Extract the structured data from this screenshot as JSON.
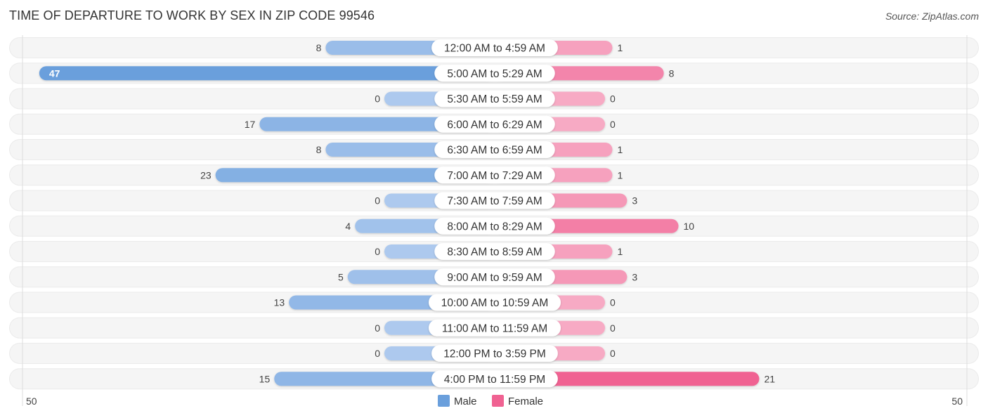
{
  "title": "TIME OF DEPARTURE TO WORK BY SEX IN ZIP CODE 99546",
  "source": "Source: ZipAtlas.com",
  "chart_data": {
    "type": "bar",
    "orientation": "horizontal-diverging",
    "title": "TIME OF DEPARTURE TO WORK BY SEX IN ZIP CODE 99546",
    "categories": [
      "12:00 AM to 4:59 AM",
      "5:00 AM to 5:29 AM",
      "5:30 AM to 5:59 AM",
      "6:00 AM to 6:29 AM",
      "6:30 AM to 6:59 AM",
      "7:00 AM to 7:29 AM",
      "7:30 AM to 7:59 AM",
      "8:00 AM to 8:29 AM",
      "8:30 AM to 8:59 AM",
      "9:00 AM to 9:59 AM",
      "10:00 AM to 10:59 AM",
      "11:00 AM to 11:59 AM",
      "12:00 PM to 3:59 PM",
      "4:00 PM to 11:59 PM"
    ],
    "series": [
      {
        "name": "Male",
        "color": "#6a9fdc",
        "values": [
          8,
          47,
          0,
          17,
          8,
          23,
          0,
          4,
          0,
          5,
          13,
          0,
          0,
          15
        ]
      },
      {
        "name": "Female",
        "color": "#f06292",
        "values": [
          1,
          8,
          0,
          0,
          1,
          1,
          3,
          10,
          1,
          3,
          0,
          0,
          0,
          21
        ]
      }
    ],
    "axis": {
      "left_label": "50",
      "right_label": "50",
      "xlim": [
        -50,
        50
      ]
    },
    "legend": {
      "position": "bottom-center",
      "items": [
        "Male",
        "Female"
      ]
    }
  }
}
